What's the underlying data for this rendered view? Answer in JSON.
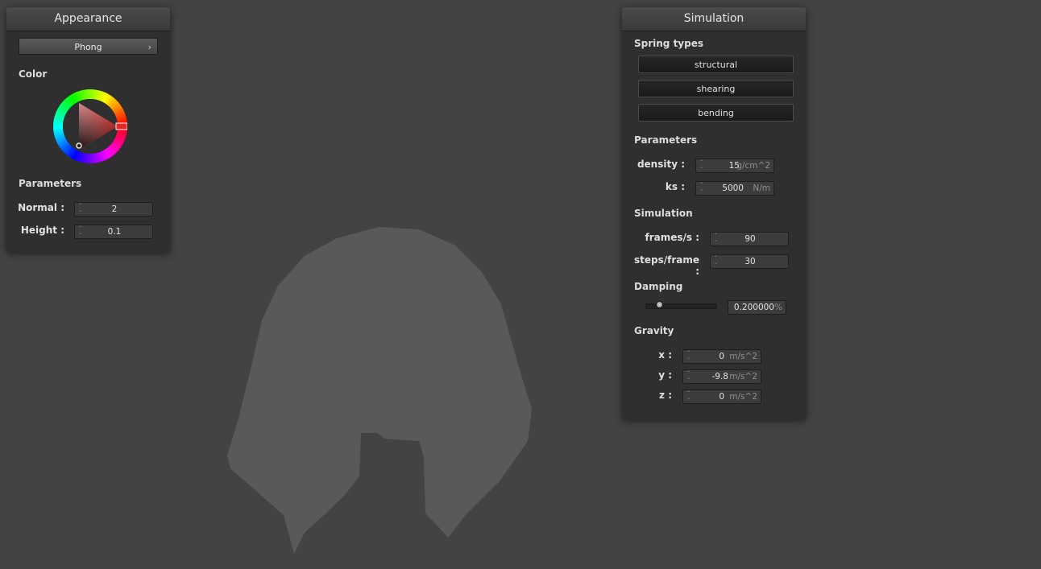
{
  "appearance": {
    "title": "Appearance",
    "shading_mode": "Phong",
    "color_label": "Color",
    "color_value": "#d93030",
    "parameters_label": "Parameters",
    "normal": {
      "label": "Normal :",
      "value": "2"
    },
    "height": {
      "label": "Height :",
      "value": "0.1"
    }
  },
  "simulation": {
    "title": "Simulation",
    "spring_types_label": "Spring types",
    "spring_types": [
      "structural",
      "shearing",
      "bending"
    ],
    "parameters_label": "Parameters",
    "density": {
      "label": "density :",
      "value": "15",
      "unit": "g/cm^2"
    },
    "ks": {
      "label": "ks :",
      "value": "5000",
      "unit": "N/m"
    },
    "simulation_label": "Simulation",
    "frames_per_s": {
      "label": "frames/s :",
      "value": "90"
    },
    "steps_per_frame": {
      "label": "steps/frame :",
      "value": "30"
    },
    "damping_label": "Damping",
    "damping": {
      "value": "0.200000",
      "unit": "%",
      "slider_fraction": 0.2
    },
    "gravity_label": "Gravity",
    "gravity": [
      {
        "label": "x :",
        "value": "0",
        "unit": "m/s^2"
      },
      {
        "label": "y :",
        "value": "-9.8",
        "unit": "m/s^2"
      },
      {
        "label": "z :",
        "value": "0",
        "unit": "m/s^2"
      }
    ]
  },
  "icons": {
    "combo_chevron": "chevron-right-icon",
    "spinner": "spinner-arrows-icon"
  },
  "colors": {
    "background": "#434343",
    "cloth": "#595959",
    "panel": "#2f2f2f"
  }
}
